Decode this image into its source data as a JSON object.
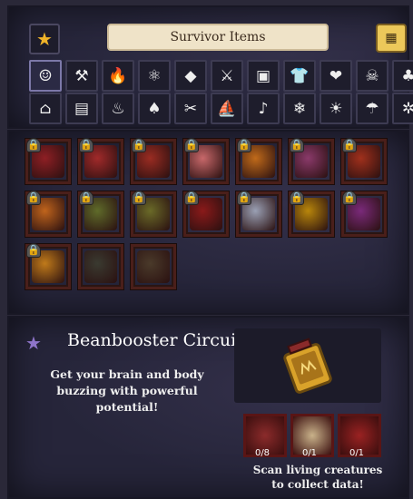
{
  "header": {
    "title": "Survivor Items"
  },
  "filters_row1": [
    {
      "icon": "face-icon",
      "glyph": "☺",
      "active": true
    },
    {
      "icon": "axe-pickaxe-icon",
      "glyph": "⚒"
    },
    {
      "icon": "fire-icon",
      "glyph": "🔥"
    },
    {
      "icon": "atom-icon",
      "glyph": "⚛"
    },
    {
      "icon": "diamond-icon",
      "glyph": "◆"
    },
    {
      "icon": "crossed-swords-icon",
      "glyph": "⚔"
    },
    {
      "icon": "armor-icon",
      "glyph": "▣"
    },
    {
      "icon": "shirt-icon",
      "glyph": "👕"
    },
    {
      "icon": "heart-icon",
      "glyph": "❤"
    },
    {
      "icon": "skull-icon",
      "glyph": "☠"
    },
    {
      "icon": "mushroom-icon",
      "glyph": "♣"
    }
  ],
  "filters_row2": [
    {
      "icon": "house-icon",
      "glyph": "⌂"
    },
    {
      "icon": "chest-icon",
      "glyph": "▤"
    },
    {
      "icon": "pot-icon",
      "glyph": "♨"
    },
    {
      "icon": "sapling-icon",
      "glyph": "♠"
    },
    {
      "icon": "tools-icon",
      "glyph": "✂"
    },
    {
      "icon": "boat-icon",
      "glyph": "⛵"
    },
    {
      "icon": "bird-icon",
      "glyph": "♪"
    },
    {
      "icon": "snowflake-icon",
      "glyph": "❄"
    },
    {
      "icon": "sun-icon",
      "glyph": "☀"
    },
    {
      "icon": "umbrella-icon",
      "glyph": "☂"
    },
    {
      "icon": "gear-flower-icon",
      "glyph": "✲"
    }
  ],
  "items": [
    {
      "name": "item-1",
      "color": "#8e1f24",
      "locked": true
    },
    {
      "name": "item-2",
      "color": "#a12a2a",
      "locked": true
    },
    {
      "name": "item-3",
      "color": "#9a2c22",
      "locked": true
    },
    {
      "name": "item-4",
      "color": "#c8686a",
      "locked": true
    },
    {
      "name": "item-5",
      "color": "#c06a1a",
      "locked": true
    },
    {
      "name": "item-6",
      "color": "#8a3a6a",
      "locked": true
    },
    {
      "name": "item-7",
      "color": "#a0301c",
      "locked": true
    },
    {
      "name": "item-8",
      "color": "#c0641c",
      "locked": true
    },
    {
      "name": "item-9",
      "color": "#5f6b2a",
      "locked": true
    },
    {
      "name": "item-10",
      "color": "#6a6a28",
      "locked": true
    },
    {
      "name": "item-11",
      "color": "#8a1a1a",
      "locked": true
    },
    {
      "name": "item-12",
      "color": "#9aa0b4",
      "locked": true
    },
    {
      "name": "item-13",
      "color": "#b8860b",
      "locked": true
    },
    {
      "name": "item-14",
      "color": "#7a2a7a",
      "locked": true
    },
    {
      "name": "item-15",
      "color": "#c07a1a",
      "locked": true
    },
    {
      "name": "item-16",
      "color": "#3a3a30",
      "locked": false
    },
    {
      "name": "item-17",
      "color": "#4a3a2a",
      "locked": false
    }
  ],
  "detail": {
    "name": "Beanbooster Circuit",
    "description": "Get your brain and body buzzing with powerful potential!",
    "requirements": [
      {
        "count": "0/8",
        "color": "#8b2b2b"
      },
      {
        "count": "0/1",
        "color": "#c9b28a"
      },
      {
        "count": "0/1",
        "color": "#9a2222"
      }
    ],
    "scan_hint": "Scan living creatures to collect data!"
  }
}
